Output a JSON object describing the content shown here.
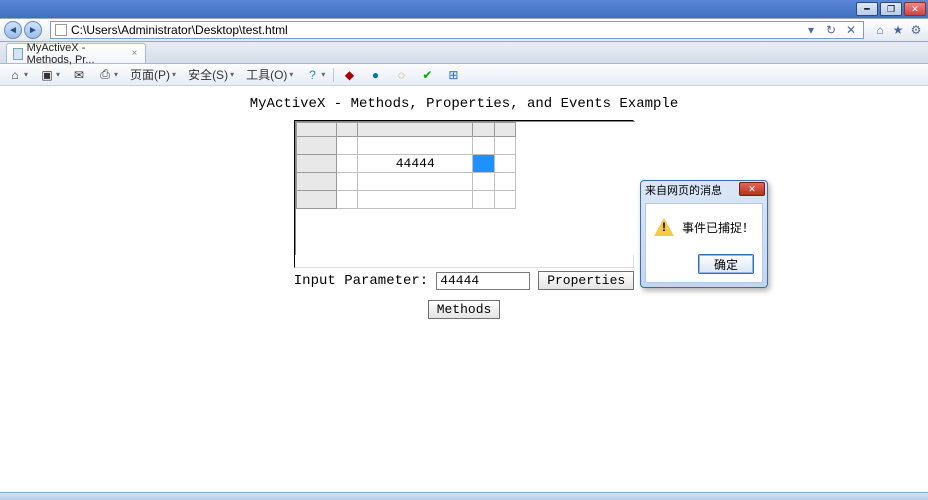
{
  "window": {
    "minimize_glyph": "━",
    "maximize_glyph": "❐",
    "close_glyph": "✕"
  },
  "nav": {
    "back_glyph": "◄",
    "fwd_glyph": "►",
    "url": "C:\\Users\\Administrator\\Desktop\\test.html",
    "drop_glyph": "▾",
    "refresh_glyph": "↻",
    "stop_glyph": "✕"
  },
  "right_tools": {
    "home_glyph": "⌂",
    "fav_glyph": "★",
    "gear_glyph": "⚙"
  },
  "tab": {
    "title": "MyActiveX - Methods, Pr...",
    "close_glyph": "×"
  },
  "cmdbar": {
    "home_glyph": "⌂",
    "rss_glyph": "▣",
    "mail_glyph": "✉",
    "print_glyph": "⎙",
    "page_label": "页面(P)",
    "safety_label": "安全(S)",
    "tools_label": "工具(O)",
    "help_glyph": "?",
    "drop_glyph": "▾"
  },
  "content": {
    "title": "MyActiveX - Methods, Properties, and Events Example",
    "grid_value": "44444",
    "input_label": "Input Parameter:",
    "input_value": "44444",
    "properties_btn": "Properties",
    "methods_btn": "Methods"
  },
  "dialog": {
    "title": "来自网页的消息",
    "message": "事件已捕捉！",
    "ok_label": "确定",
    "close_glyph": "✕"
  }
}
